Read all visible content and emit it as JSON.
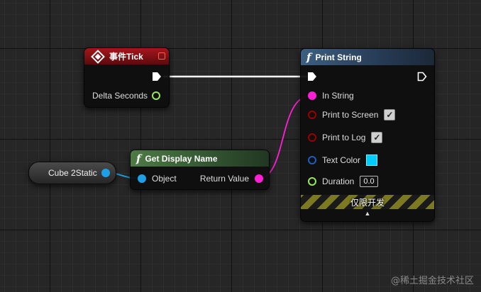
{
  "event_tick_node": {
    "title": "事件Tick",
    "pin_delta_seconds": "Delta Seconds",
    "header_color": "#8f1418"
  },
  "print_string_node": {
    "title": "Print String",
    "pins": {
      "in_string": "In String",
      "print_to_screen": "Print to Screen",
      "print_to_log": "Print to Log",
      "text_color": "Text Color",
      "duration": "Duration"
    },
    "values": {
      "print_to_screen_checked": true,
      "print_to_log_checked": true,
      "text_color": "#00ccff",
      "duration": "0.0"
    },
    "development_only_label": "仅限开发",
    "expand_arrow": "▲"
  },
  "get_display_name_node": {
    "title": "Get Display Name",
    "input_pin": "Object",
    "output_pin": "Return Value"
  },
  "variable_node": {
    "label": "Cube 2Static"
  },
  "checkbox_glyph": "✓",
  "icons": {
    "function": "function-f-icon",
    "event": "event-diamond-icon",
    "exec": "exec-pin-icon"
  },
  "pin_colors": {
    "exec": "#ffffff",
    "float": "#9ae65a",
    "object": "#1ea0e6",
    "string": "#ff1fd6",
    "bool": "#990000",
    "struct_color": "#1a5fc0"
  },
  "watermark": "@稀土掘金技术社区"
}
